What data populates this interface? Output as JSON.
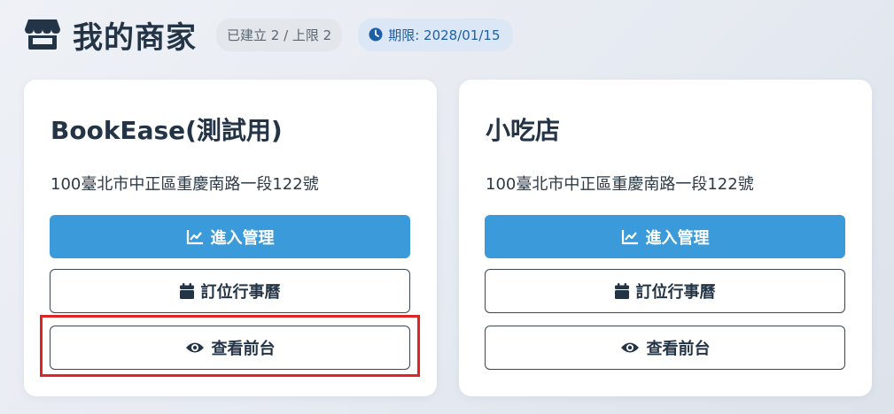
{
  "header": {
    "title": "我的商家",
    "count_badge": "已建立 2 / 上限 2",
    "expiry_badge": "期限: 2028/01/15",
    "icon": "store-icon"
  },
  "stores": [
    {
      "name": "BookEase(測試用)",
      "address": "100臺北市中正區重慶南路一段122號",
      "manage_label": "進入管理",
      "calendar_label": "訂位行事曆",
      "view_label": "查看前台"
    },
    {
      "name": "小吃店",
      "address": "100臺北市中正區重慶南路一段122號",
      "manage_label": "進入管理",
      "calendar_label": "訂位行事曆",
      "view_label": "查看前台"
    }
  ],
  "colors": {
    "primary": "#3b9ad9",
    "text": "#243447",
    "highlight": "#e02424",
    "expiry_badge_bg": "#dbe7f5"
  },
  "icons": [
    "store-icon",
    "clock-icon",
    "chart-line-icon",
    "calendar-icon",
    "eye-icon"
  ]
}
